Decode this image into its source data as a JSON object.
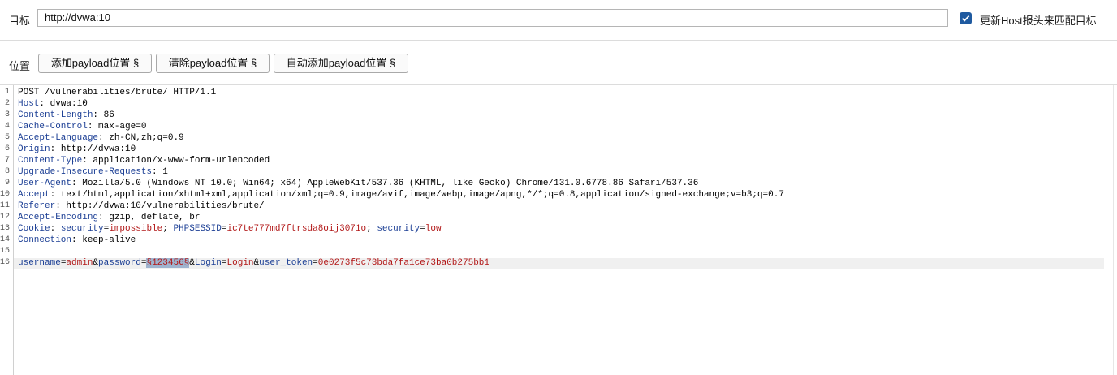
{
  "target": {
    "label": "目标",
    "url": "http://dvwa:10",
    "update_host_label": "更新Host报头来匹配目标",
    "update_host_checked": true
  },
  "positions": {
    "label": "位置",
    "add_button": "添加payload位置 §",
    "clear_button": "清除payload位置 §",
    "auto_button": "自动添加payload位置 §"
  },
  "request": {
    "line_numbers": [
      "1",
      "2",
      "3",
      "4",
      "5",
      "6",
      "7",
      "8",
      "9",
      "10",
      "11",
      "12",
      "13",
      "14",
      "15",
      "16"
    ],
    "request_line": "POST /vulnerabilities/brute/ HTTP/1.1",
    "headers": [
      {
        "name": "Host",
        "value": "dvwa:10"
      },
      {
        "name": "Content-Length",
        "value": "86"
      },
      {
        "name": "Cache-Control",
        "value": "max-age=0"
      },
      {
        "name": "Accept-Language",
        "value": "zh-CN,zh;q=0.9"
      },
      {
        "name": "Origin",
        "value": "http://dvwa:10"
      },
      {
        "name": "Content-Type",
        "value": "application/x-www-form-urlencoded"
      },
      {
        "name": "Upgrade-Insecure-Requests",
        "value": "1"
      },
      {
        "name": "User-Agent",
        "value": "Mozilla/5.0 (Windows NT 10.0; Win64; x64) AppleWebKit/537.36 (KHTML, like Gecko) Chrome/131.0.6778.86 Safari/537.36"
      },
      {
        "name": "Accept",
        "value": "text/html,application/xhtml+xml,application/xml;q=0.9,image/avif,image/webp,image/apng,*/*;q=0.8,application/signed-exchange;v=b3;q=0.7"
      },
      {
        "name": "Referer",
        "value": "http://dvwa:10/vulnerabilities/brute/"
      },
      {
        "name": "Accept-Encoding",
        "value": "gzip, deflate, br"
      },
      {
        "name": "Connection",
        "value": "keep-alive"
      }
    ],
    "cookie": {
      "name": "Cookie",
      "security_name": "security",
      "security_value": "impossible",
      "phpsessid_name": "PHPSESSID",
      "phpsessid_value": "ic7te777md7ftrsda8oij3071o",
      "security2_name": "security",
      "security2_value": "low"
    },
    "body": {
      "username_name": "username",
      "username_value": "admin",
      "password_name": "password",
      "password_payload": "§123456§",
      "login_name": "Login",
      "login_value": "Login",
      "token_name": "user_token",
      "token_value": "0e0273f5c73bda7fa1ce73ba0b275bb1"
    }
  }
}
